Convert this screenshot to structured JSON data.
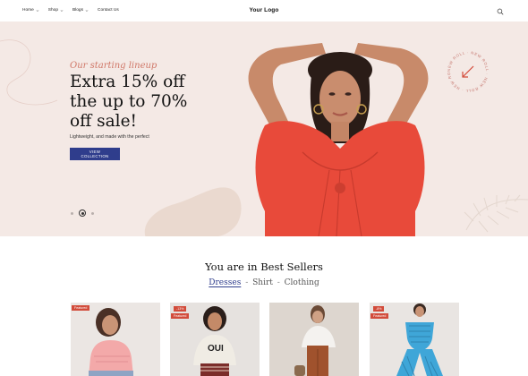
{
  "header": {
    "nav": [
      {
        "label": "Home"
      },
      {
        "label": "Shop"
      },
      {
        "label": "Blogs"
      },
      {
        "label": "Contact Us"
      }
    ],
    "logo": "Your Logo",
    "search_icon": "search-icon"
  },
  "hero": {
    "tagline": "Our starting lineup",
    "headline_lines": [
      "Extra 15% off",
      "the up to 70%",
      "off sale!"
    ],
    "subtext": "Lightweight, and made with the perfect",
    "cta_label": "VIEW COLLECTION",
    "slider_index": 2,
    "slider_count": 3,
    "badge_text": "NEW ROLL · NEW ROLL · NEW ROLL · NEW ROLL ·",
    "colors": {
      "background": "#f4e9e5",
      "accent": "#d07768",
      "button": "#2f3d8c",
      "dress": "#e84a3a"
    }
  },
  "best_sellers": {
    "title": "You are in Best Sellers",
    "tabs": [
      {
        "label": "Dresses",
        "active": true
      },
      {
        "label": "Shirt",
        "active": false
      },
      {
        "label": "Clothing",
        "active": false
      }
    ],
    "separator": "-",
    "products": [
      {
        "badges": [
          "Featured"
        ]
      },
      {
        "badges": [
          "-13%",
          "Featured"
        ]
      },
      {
        "badges": []
      },
      {
        "badges": [
          "-8%",
          "Featured"
        ]
      }
    ]
  }
}
